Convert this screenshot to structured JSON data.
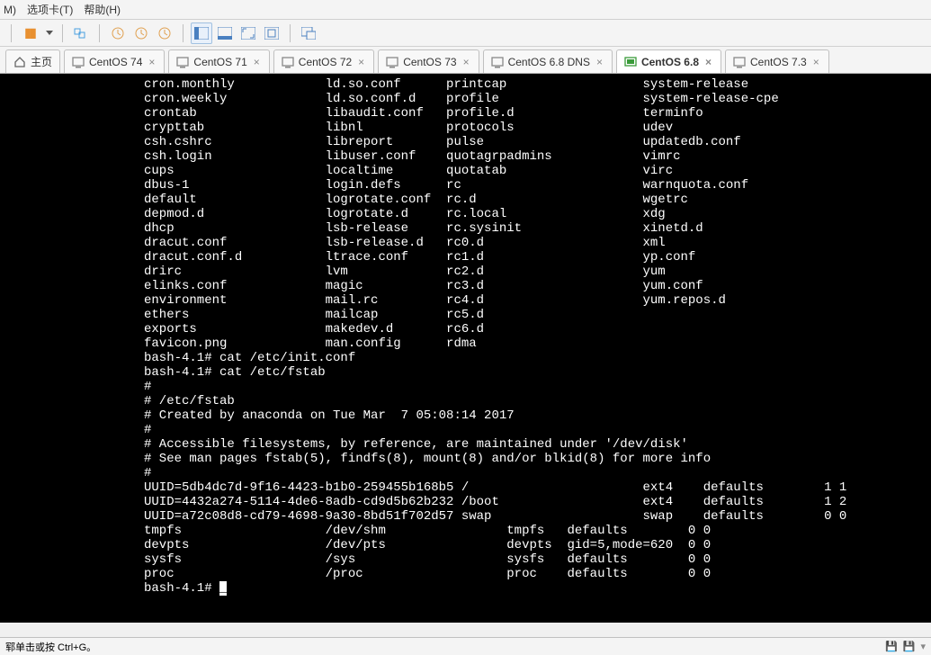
{
  "menu": {
    "m": "M)",
    "tabs": "选项卡(T)",
    "help": "帮助(H)"
  },
  "tabs": [
    {
      "label": "主页",
      "type": "home",
      "closable": false,
      "active": false
    },
    {
      "label": "CentOS 74",
      "type": "vm",
      "closable": true,
      "active": false
    },
    {
      "label": "CentOS 71",
      "type": "vm",
      "closable": true,
      "active": false
    },
    {
      "label": "CentOS 72",
      "type": "vm",
      "closable": true,
      "active": false
    },
    {
      "label": "CentOS 73",
      "type": "vm",
      "closable": true,
      "active": false
    },
    {
      "label": "CentOS 6.8 DNS",
      "type": "vm",
      "closable": true,
      "active": false
    },
    {
      "label": "CentOS 6.8",
      "type": "vm-on",
      "closable": true,
      "active": true
    },
    {
      "label": "CentOS 7.3",
      "type": "vm",
      "closable": true,
      "active": false
    }
  ],
  "listing": [
    [
      "cron.monthly",
      "ld.so.conf",
      "printcap",
      "system-release"
    ],
    [
      "cron.weekly",
      "ld.so.conf.d",
      "profile",
      "system-release-cpe"
    ],
    [
      "crontab",
      "libaudit.conf",
      "profile.d",
      "terminfo"
    ],
    [
      "crypttab",
      "libnl",
      "protocols",
      "udev"
    ],
    [
      "csh.cshrc",
      "libreport",
      "pulse",
      "updatedb.conf"
    ],
    [
      "csh.login",
      "libuser.conf",
      "quotagrpadmins",
      "vimrc"
    ],
    [
      "cups",
      "localtime",
      "quotatab",
      "virc"
    ],
    [
      "dbus-1",
      "login.defs",
      "rc",
      "warnquota.conf"
    ],
    [
      "default",
      "logrotate.conf",
      "rc.d",
      "wgetrc"
    ],
    [
      "depmod.d",
      "logrotate.d",
      "rc.local",
      "xdg"
    ],
    [
      "dhcp",
      "lsb-release",
      "rc.sysinit",
      "xinetd.d"
    ],
    [
      "dracut.conf",
      "lsb-release.d",
      "rc0.d",
      "xml"
    ],
    [
      "dracut.conf.d",
      "ltrace.conf",
      "rc1.d",
      "yp.conf"
    ],
    [
      "drirc",
      "lvm",
      "rc2.d",
      "yum"
    ],
    [
      "elinks.conf",
      "magic",
      "rc3.d",
      "yum.conf"
    ],
    [
      "environment",
      "mail.rc",
      "rc4.d",
      "yum.repos.d"
    ],
    [
      "ethers",
      "mailcap",
      "rc5.d",
      ""
    ],
    [
      "exports",
      "makedev.d",
      "rc6.d",
      ""
    ],
    [
      "favicon.png",
      "man.config",
      "rdma",
      ""
    ]
  ],
  "cmd1": "bash-4.1# cat /etc/init.conf",
  "cmd2": "bash-4.1# cat /etc/fstab",
  "fstab": [
    "",
    "#",
    "# /etc/fstab",
    "# Created by anaconda on Tue Mar  7 05:08:14 2017",
    "#",
    "# Accessible filesystems, by reference, are maintained under '/dev/disk'",
    "# See man pages fstab(5), findfs(8), mount(8) and/or blkid(8) for more info",
    "#",
    "UUID=5db4dc7d-9f16-4423-b1b0-259455b168b5 /                       ext4    defaults        1 1",
    "UUID=4432a274-5114-4de6-8adb-cd9d5b62b232 /boot                   ext4    defaults        1 2",
    "UUID=a72c08d8-cd79-4698-9a30-8bd51f702d57 swap                    swap    defaults        0 0",
    "tmpfs                   /dev/shm                tmpfs   defaults        0 0",
    "devpts                  /dev/pts                devpts  gid=5,mode=620  0 0",
    "sysfs                   /sys                    sysfs   defaults        0 0",
    "proc                    /proc                   proc    defaults        0 0"
  ],
  "prompt": "bash-4.1# ",
  "status": "郓单击或按 Ctrl+G。"
}
